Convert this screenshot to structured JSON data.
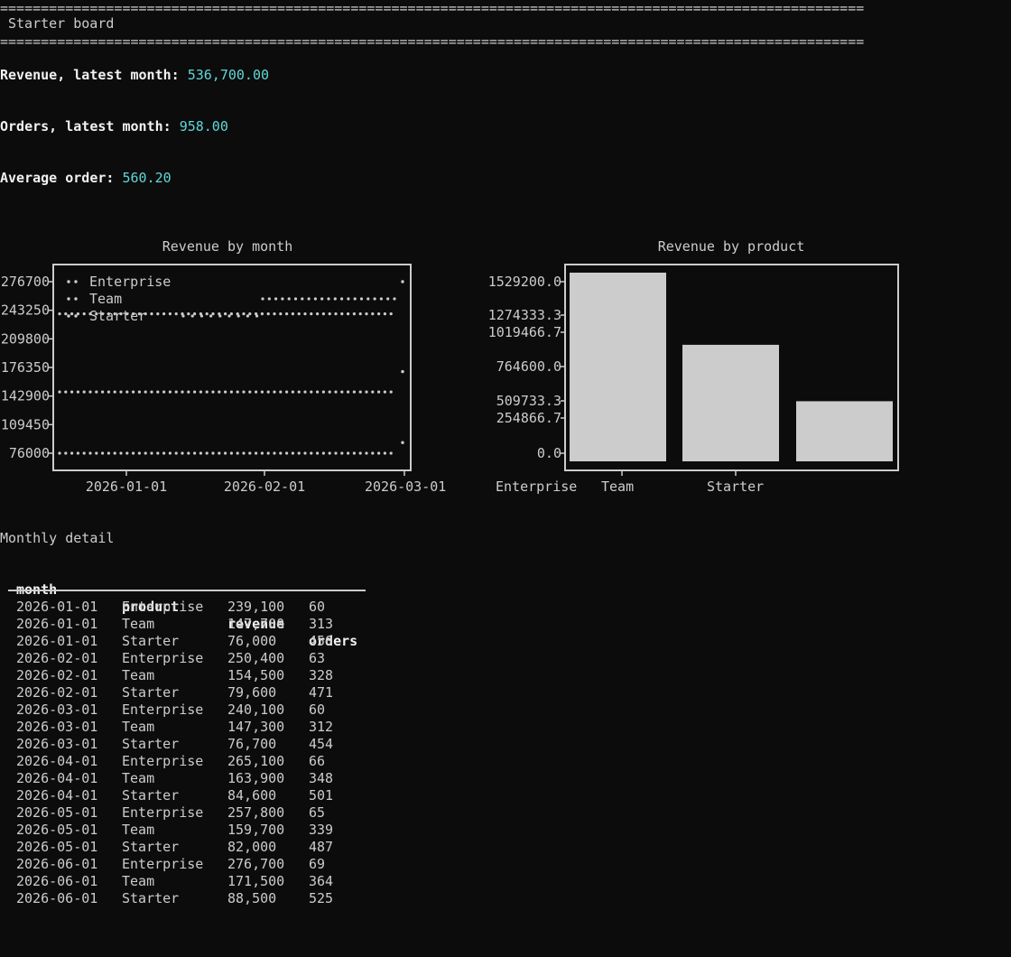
{
  "header": {
    "rule": "==========================================================================================================",
    "title": "Starter board"
  },
  "metrics": [
    {
      "label": "Revenue, latest month: ",
      "value": "536,700.00"
    },
    {
      "label": "Orders, latest month: ",
      "value": "958.00"
    },
    {
      "label": "Average order: ",
      "value": "560.20"
    }
  ],
  "chart_data": [
    {
      "type": "scatter",
      "title": "Revenue by month",
      "y_ticks": [
        "276700",
        "243250",
        "209800",
        "176350",
        "142900",
        "109450",
        "76000"
      ],
      "x_ticks": [
        "2026-01-01",
        "2026-02-01",
        "2026-03-01"
      ],
      "legend": "top-left",
      "series": [
        {
          "name": "Enterprise",
          "x": [
            "2026-01-01",
            "2026-02-01",
            "2026-03-01",
            "2026-04-01",
            "2026-05-01",
            "2026-06-01"
          ],
          "values": [
            239100,
            250400,
            240100,
            265100,
            257800,
            276700
          ]
        },
        {
          "name": "Team",
          "x": [
            "2026-01-01",
            "2026-02-01",
            "2026-03-01",
            "2026-04-01",
            "2026-05-01",
            "2026-06-01"
          ],
          "values": [
            147700,
            154500,
            147300,
            163900,
            159700,
            171500
          ]
        },
        {
          "name": "Starter",
          "x": [
            "2026-01-01",
            "2026-02-01",
            "2026-03-01",
            "2026-04-01",
            "2026-05-01",
            "2026-06-01"
          ],
          "values": [
            76000,
            79600,
            76700,
            84600,
            82000,
            88500
          ]
        }
      ],
      "ylim": [
        76000,
        276700
      ]
    },
    {
      "type": "bar",
      "title": "Revenue by product",
      "categories": [
        "Enterprise",
        "Team",
        "Starter"
      ],
      "values": [
        1529200,
        944400,
        487400
      ],
      "y_ticks": [
        "1529200.0",
        "1274333.3",
        "1019466.7",
        "764600.0",
        "509733.3",
        "254866.7",
        "0.0"
      ],
      "ylim": [
        0,
        1529200
      ]
    }
  ],
  "table": {
    "caption": "Monthly detail",
    "columns": [
      "month",
      "product",
      "revenue",
      "orders"
    ],
    "rows": [
      [
        "2026-01-01",
        "Enterprise",
        "239,100",
        "60"
      ],
      [
        "2026-01-01",
        "Team",
        "147,700",
        "313"
      ],
      [
        "2026-01-01",
        "Starter",
        "76,000",
        "450"
      ],
      [
        "2026-02-01",
        "Enterprise",
        "250,400",
        "63"
      ],
      [
        "2026-02-01",
        "Team",
        "154,500",
        "328"
      ],
      [
        "2026-02-01",
        "Starter",
        "79,600",
        "471"
      ],
      [
        "2026-03-01",
        "Enterprise",
        "240,100",
        "60"
      ],
      [
        "2026-03-01",
        "Team",
        "147,300",
        "312"
      ],
      [
        "2026-03-01",
        "Starter",
        "76,700",
        "454"
      ],
      [
        "2026-04-01",
        "Enterprise",
        "265,100",
        "66"
      ],
      [
        "2026-04-01",
        "Team",
        "163,900",
        "348"
      ],
      [
        "2026-04-01",
        "Starter",
        "84,600",
        "501"
      ],
      [
        "2026-05-01",
        "Enterprise",
        "257,800",
        "65"
      ],
      [
        "2026-05-01",
        "Team",
        "159,700",
        "339"
      ],
      [
        "2026-05-01",
        "Starter",
        "82,000",
        "487"
      ],
      [
        "2026-06-01",
        "Enterprise",
        "276,700",
        "69"
      ],
      [
        "2026-06-01",
        "Team",
        "171,500",
        "364"
      ],
      [
        "2026-06-01",
        "Starter",
        "88,500",
        "525"
      ]
    ]
  }
}
